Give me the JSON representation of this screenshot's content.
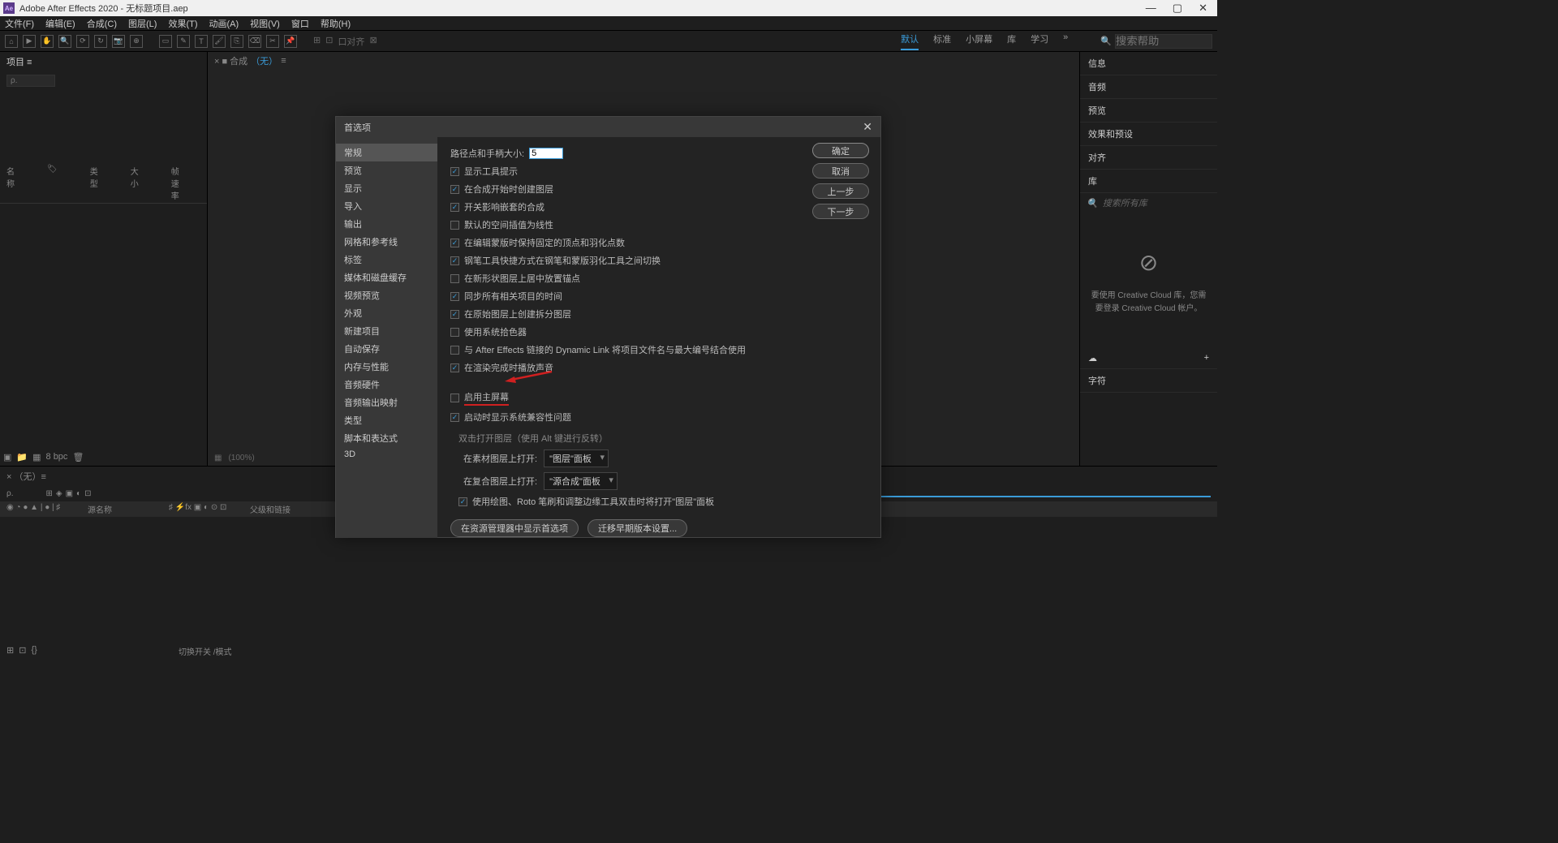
{
  "title": "Adobe After Effects 2020 - 无标题项目.aep",
  "ae_abbr": "Ae",
  "menu": [
    "文件(F)",
    "编辑(E)",
    "合成(C)",
    "图层(L)",
    "效果(T)",
    "动画(A)",
    "视图(V)",
    "窗口",
    "帮助(H)"
  ],
  "workspaces": {
    "default": "默认",
    "standard": "标准",
    "small": "小屏幕",
    "lib": "库",
    "learn": "学习",
    "more": "»"
  },
  "search_top": "搜索帮助",
  "align_label": "口对齐",
  "project_tab": "项目 ≡",
  "project_cols": {
    "name": "名称",
    "type": "类型",
    "size": "大小",
    "fr": "帧速率"
  },
  "bpc": "8 bpc",
  "comp_tab_prefix": "× ■ 合成",
  "comp_none": "（无）",
  "comp_eq": "≡",
  "right_panels": [
    "信息",
    "音频",
    "预览",
    "效果和预设",
    "对齐",
    "库"
  ],
  "right_search": "搜索所有库",
  "cc_msg": "要使用 Creative Cloud 库，您需要登录 Creative Cloud 帐户。",
  "right_bottom": "字符",
  "tl_tab": "× （无）≡",
  "tl_source": "源名称",
  "tl_parent": "父级和链接",
  "tl_footer": "切换开关 /模式",
  "dialog": {
    "title": "首选项",
    "categories": [
      "常规",
      "预览",
      "显示",
      "导入",
      "输出",
      "网格和参考线",
      "标签",
      "媒体和磁盘缓存",
      "视频预览",
      "外观",
      "新建项目",
      "自动保存",
      "内存与性能",
      "音频硬件",
      "音频输出映射",
      "类型",
      "脚本和表达式",
      "3D"
    ],
    "path_label": "路径点和手柄大小:",
    "path_value": "5",
    "checks": [
      {
        "label": "显示工具提示",
        "c": true
      },
      {
        "label": "在合成开始时创建图层",
        "c": true
      },
      {
        "label": "开关影响嵌套的合成",
        "c": true
      },
      {
        "label": "默认的空间插值为线性",
        "c": false
      },
      {
        "label": "在编辑蒙版时保持固定的顶点和羽化点数",
        "c": true
      },
      {
        "label": "钢笔工具快捷方式在钢笔和蒙版羽化工具之间切换",
        "c": true
      },
      {
        "label": "在新形状图层上居中放置锚点",
        "c": false
      },
      {
        "label": "同步所有相关项目的时间",
        "c": true
      },
      {
        "label": "在原始图层上创建拆分图层",
        "c": true
      },
      {
        "label": "使用系统拾色器",
        "c": false
      },
      {
        "label": "与 After Effects 链接的 Dynamic Link 将项目文件名与最大编号结合使用",
        "c": false
      },
      {
        "label": "在渲染完成时播放声音",
        "c": true
      }
    ],
    "home_check": {
      "label": "启用主屏幕",
      "c": false
    },
    "compat_check": {
      "label": "启动时显示系统兼容性问题",
      "c": true
    },
    "dbl_section": "双击打开图层（使用 Alt 键进行反转）",
    "open_footage": "在素材图层上打开:",
    "open_footage_val": "\"图层\"面板",
    "open_comp": "在复合图层上打开:",
    "open_comp_val": "\"源合成\"面板",
    "paint_check": {
      "label": "使用绘图、Roto 笔刷和调整边缘工具双击时将打开\"图层\"面板",
      "c": true
    },
    "btn_explorer": "在资源管理器中显示首选项",
    "btn_migrate": "迁移早期版本设置...",
    "ok": "确定",
    "cancel": "取消",
    "prev": "上一步",
    "next": "下一步"
  }
}
